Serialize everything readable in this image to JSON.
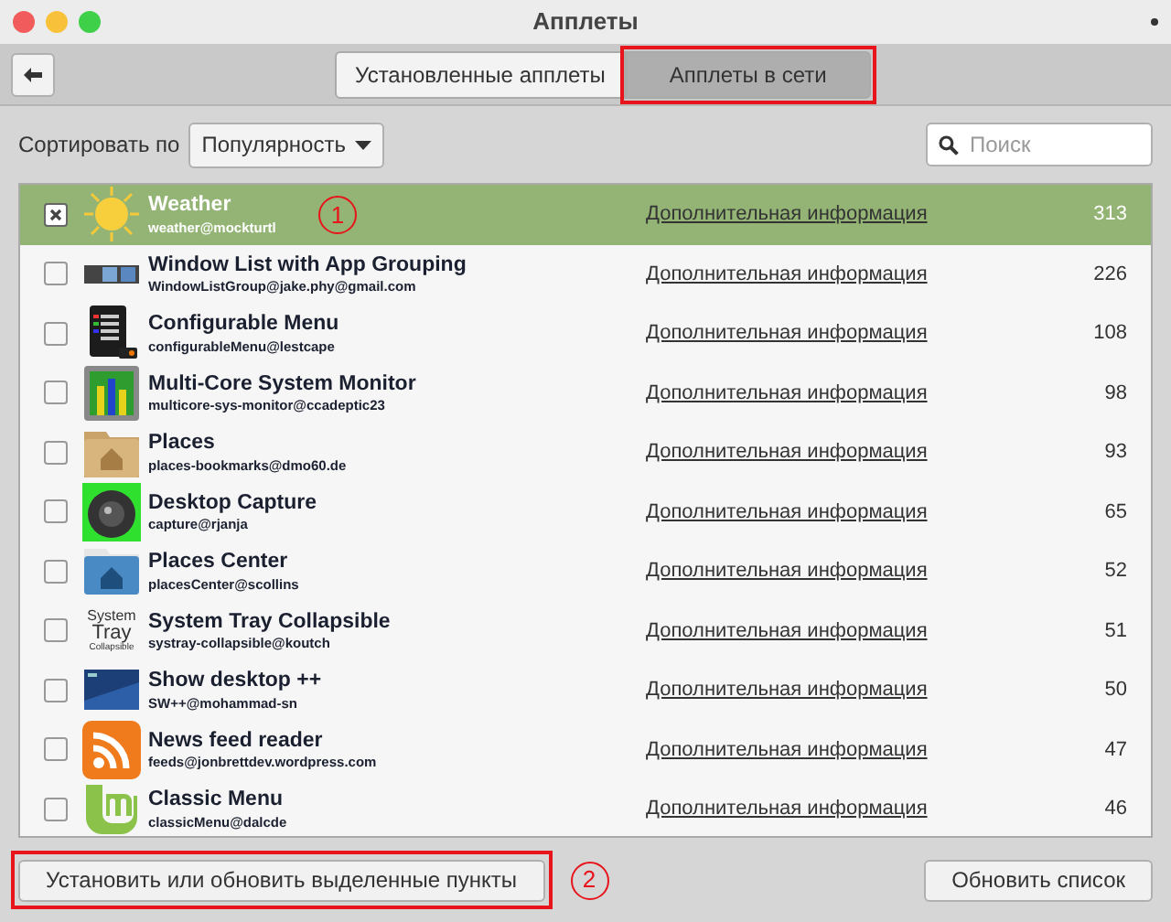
{
  "window": {
    "title": "Апплеты"
  },
  "tabs": [
    {
      "label": "Установленные апплеты",
      "selected": false,
      "highlighted": false
    },
    {
      "label": "Апплеты в сети",
      "selected": true,
      "highlighted": true
    }
  ],
  "sort": {
    "label": "Сортировать по",
    "value": "Популярность"
  },
  "search": {
    "placeholder": "Поиск"
  },
  "applets": [
    {
      "name": "Weather",
      "id": "weather@mockturtl",
      "link": "Дополнительная информация",
      "score": "313",
      "checked": true,
      "selected": true,
      "callout": "1"
    },
    {
      "name": "Window List with App Grouping",
      "id": "WindowListGroup@jake.phy@gmail.com",
      "link": "Дополнительная информация",
      "score": "226",
      "checked": false,
      "selected": false
    },
    {
      "name": "Configurable Menu",
      "id": "configurableMenu@lestcape",
      "link": "Дополнительная информация",
      "score": "108",
      "checked": false,
      "selected": false
    },
    {
      "name": "Multi-Core System Monitor",
      "id": "multicore-sys-monitor@ccadeptic23",
      "link": "Дополнительная информация",
      "score": "98",
      "checked": false,
      "selected": false
    },
    {
      "name": "Places",
      "id": "places-bookmarks@dmo60.de",
      "link": "Дополнительная информация",
      "score": "93",
      "checked": false,
      "selected": false
    },
    {
      "name": "Desktop Capture",
      "id": "capture@rjanja",
      "link": "Дополнительная информация",
      "score": "65",
      "checked": false,
      "selected": false
    },
    {
      "name": "Places Center",
      "id": "placesCenter@scollins",
      "link": "Дополнительная информация",
      "score": "52",
      "checked": false,
      "selected": false
    },
    {
      "name": "System Tray Collapsible",
      "id": "systray-collapsible@koutch",
      "link": "Дополнительная информация",
      "score": "51",
      "checked": false,
      "selected": false,
      "icon_text": [
        "System",
        "Tray",
        "Collapsible"
      ]
    },
    {
      "name": "Show desktop ++",
      "id": "SW++@mohammad-sn",
      "link": "Дополнительная информация",
      "score": "50",
      "checked": false,
      "selected": false
    },
    {
      "name": "News feed reader",
      "id": "feeds@jonbrettdev.wordpress.com",
      "link": "Дополнительная информация",
      "score": "47",
      "checked": false,
      "selected": false
    },
    {
      "name": "Classic Menu",
      "id": "classicMenu@dalcde",
      "link": "Дополнительная информация",
      "score": "46",
      "checked": false,
      "selected": false
    }
  ],
  "buttons": [
    {
      "label": "Установить или обновить выделенные пункты",
      "highlighted": true,
      "callout": "2"
    },
    {
      "label": "Обновить список",
      "highlighted": false
    }
  ]
}
